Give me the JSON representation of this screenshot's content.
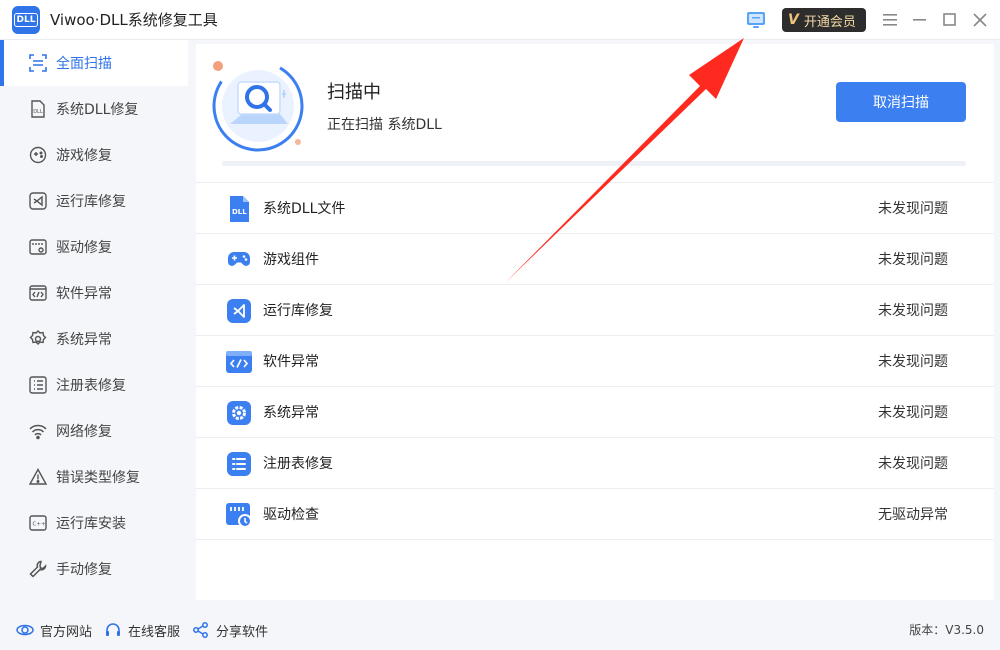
{
  "app": {
    "title": "Viwoo·DLL系统修复工具",
    "logo_text": "DLL"
  },
  "titlebar": {
    "vip_label": "开通会员",
    "vip_mark": "V"
  },
  "sidebar": {
    "items": [
      {
        "label": "全面扫描",
        "icon": "full-scan-icon",
        "active": true
      },
      {
        "label": "系统DLL修复",
        "icon": "dll-file-icon"
      },
      {
        "label": "游戏修复",
        "icon": "gamepad-icon"
      },
      {
        "label": "运行库修复",
        "icon": "runtime-icon"
      },
      {
        "label": "驱动修复",
        "icon": "driver-icon"
      },
      {
        "label": "软件异常",
        "icon": "code-window-icon"
      },
      {
        "label": "系统异常",
        "icon": "gear-icon"
      },
      {
        "label": "注册表修复",
        "icon": "registry-list-icon"
      },
      {
        "label": "网络修复",
        "icon": "wifi-icon"
      },
      {
        "label": "错误类型修复",
        "icon": "warning-icon"
      },
      {
        "label": "运行库安装",
        "icon": "cpp-runtime-icon"
      },
      {
        "label": "手动修复",
        "icon": "wrench-icon"
      }
    ]
  },
  "scan": {
    "title": "扫描中",
    "subtitle": "正在扫描 系统DLL",
    "cancel_label": "取消扫描",
    "progress": 0
  },
  "results": [
    {
      "label": "系统DLL文件",
      "status": "未发现问题",
      "icon": "dll-file-icon"
    },
    {
      "label": "游戏组件",
      "status": "未发现问题",
      "icon": "gamepad-icon"
    },
    {
      "label": "运行库修复",
      "status": "未发现问题",
      "icon": "runtime-icon"
    },
    {
      "label": "软件异常",
      "status": "未发现问题",
      "icon": "code-window-icon"
    },
    {
      "label": "系统异常",
      "status": "未发现问题",
      "icon": "gear-icon"
    },
    {
      "label": "注册表修复",
      "status": "未发现问题",
      "icon": "registry-list-icon"
    },
    {
      "label": "驱动检查",
      "status": "无驱动异常",
      "icon": "driver-check-icon"
    }
  ],
  "footer": {
    "links": [
      {
        "label": "官方网站",
        "icon": "globe-icon"
      },
      {
        "label": "在线客服",
        "icon": "headset-icon"
      },
      {
        "label": "分享软件",
        "icon": "share-icon"
      }
    ],
    "version": "版本：V3.5.0"
  },
  "colors": {
    "accent": "#3b7ff0",
    "arrow": "#ff2a1f",
    "vip_bg": "#2d2d2d",
    "vip_text": "#f3d8a6"
  }
}
